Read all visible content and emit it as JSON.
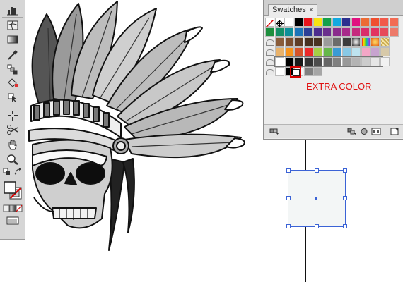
{
  "swatches_panel": {
    "tab_label": "Swatches",
    "close_glyph": "×",
    "annotation": "EXTRA COLOR",
    "annotation_color": "#e01010",
    "selection_color": "#3b63d6",
    "row1": [
      "none",
      "registration",
      "#ffffff",
      "#000000",
      "#e8141b",
      "#f7e312",
      "#14a14a",
      "#12a9e0",
      "#2c2f8f",
      "#e0117f",
      "#ec6b35",
      "#f04f2f",
      "#f15a4a",
      "#f26b53"
    ],
    "row2": [
      "#1e8f3e",
      "#138f66",
      "#0e8f9a",
      "#1c74b9",
      "#2c3f96",
      "#4d2c8e",
      "#6a2f8d",
      "#8a2b8d",
      "#a82a8a",
      "#c52a7d",
      "#d92c6a",
      "#e23160",
      "#e64a5a",
      "#ec7a6a"
    ],
    "row3": [
      "#8a5c3a",
      "#7a4d2e",
      "#5e3d26",
      "#47301f",
      "#4a3322",
      "#9b9b9b",
      "#6b6b6b",
      "#3c3c3c",
      "gradient-radial",
      "gradient-rainbow",
      "gradient-orange",
      "pattern"
    ],
    "row4": [
      "#e9b26a",
      "#f7941d",
      "#d6542a",
      "#ec2a2a",
      "#a6cf45",
      "#66b74b",
      "#3a9bd5",
      "#88c9e6",
      "#bde3ef",
      "#f3a6c6",
      "#c7a3cf",
      "#d7c9a9"
    ],
    "row5": [
      "#ffffff",
      "#000000",
      "#1a1a1a",
      "#333333",
      "#4d4d4d",
      "#666666",
      "#808080",
      "#999999",
      "#b3b3b3",
      "#cccccc",
      "#e6e6e6",
      "#f2f2f2"
    ],
    "row6": [
      "#ffffff",
      "#000000",
      "#f5f5f5",
      "#808080",
      "#a6a6a6"
    ]
  },
  "tools": [
    "column-graph-icon",
    "mesh-icon",
    "gradient-icon",
    "eyedropper-icon",
    "blend-icon",
    "live-paint-bucket-icon",
    "live-paint-selection-icon",
    "slice-icon",
    "scissors-icon",
    "hand-icon",
    "zoom-icon",
    "default-colors-icon",
    "swap-colors-icon",
    "fill-stroke-icon",
    "color-mode-icon",
    "screen-mode-icon"
  ]
}
